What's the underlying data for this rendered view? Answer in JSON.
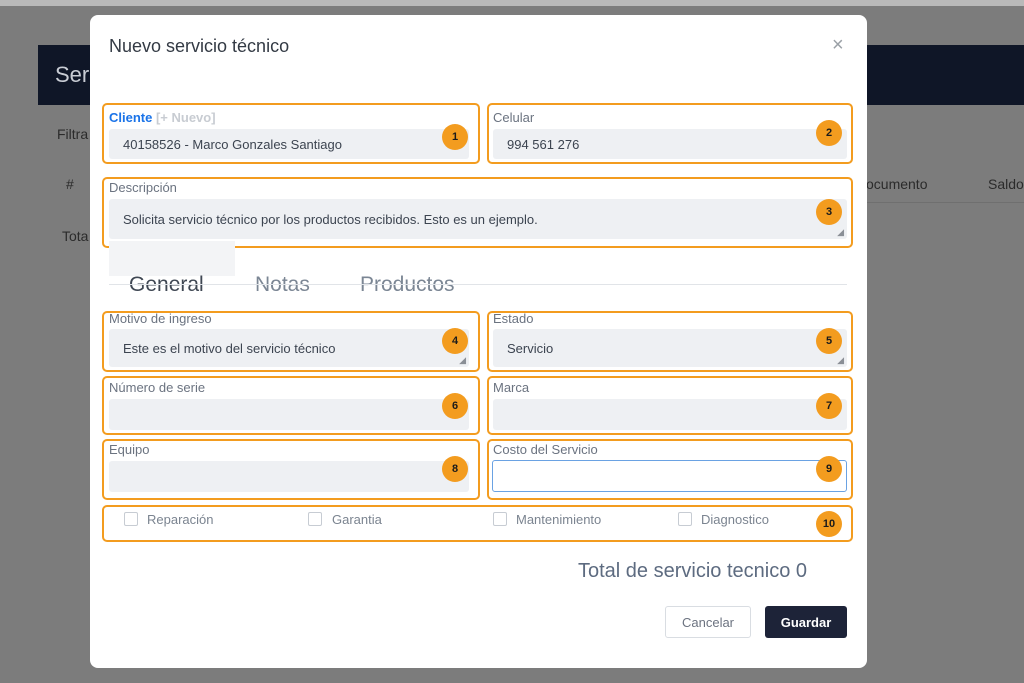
{
  "background": {
    "header_title": "Ser",
    "filter_label": "Filtra",
    "col_hash": "#",
    "col_document": "ocumento",
    "col_balance": "Saldo",
    "total_label": "Tota"
  },
  "modal": {
    "title": "Nuevo servicio técnico",
    "close_symbol": "×"
  },
  "fields": {
    "cliente": {
      "label": "Cliente",
      "new_label": "[+ Nuevo]",
      "value": "40158526 - Marco Gonzales Santiago",
      "badge": "1"
    },
    "celular": {
      "label": "Celular",
      "value": "994 561 276",
      "badge": "2"
    },
    "descripcion": {
      "label": "Descripción",
      "value": "Solicita servicio técnico por los productos recibidos. Esto es un ejemplo.",
      "badge": "3"
    },
    "motivo": {
      "label": "Motivo de ingreso",
      "value": "Este es el motivo del servicio técnico",
      "badge": "4"
    },
    "estado": {
      "label": "Estado",
      "value": "Servicio",
      "badge": "5"
    },
    "numero_serie": {
      "label": "Número de serie",
      "value": "",
      "badge": "6"
    },
    "marca": {
      "label": "Marca",
      "value": "",
      "badge": "7"
    },
    "equipo": {
      "label": "Equipo",
      "value": "",
      "badge": "8"
    },
    "costo": {
      "label": "Costo del Servicio",
      "value": "",
      "badge": "9"
    }
  },
  "tabs": [
    {
      "label": "General",
      "active": true
    },
    {
      "label": "Notas",
      "active": false
    },
    {
      "label": "Productos",
      "active": false
    }
  ],
  "checkboxes": {
    "badge": "10",
    "items": [
      {
        "label": "Reparación",
        "checked": false
      },
      {
        "label": "Garantia",
        "checked": false
      },
      {
        "label": "Mantenimiento",
        "checked": false
      },
      {
        "label": "Diagnostico",
        "checked": false
      }
    ]
  },
  "total_label": "Total de servicio tecnico 0",
  "buttons": {
    "cancel": "Cancelar",
    "save": "Guardar"
  },
  "colors": {
    "accent_orange": "#f39c1f",
    "primary_dark": "#1d2338",
    "link_blue": "#1a73e8"
  }
}
